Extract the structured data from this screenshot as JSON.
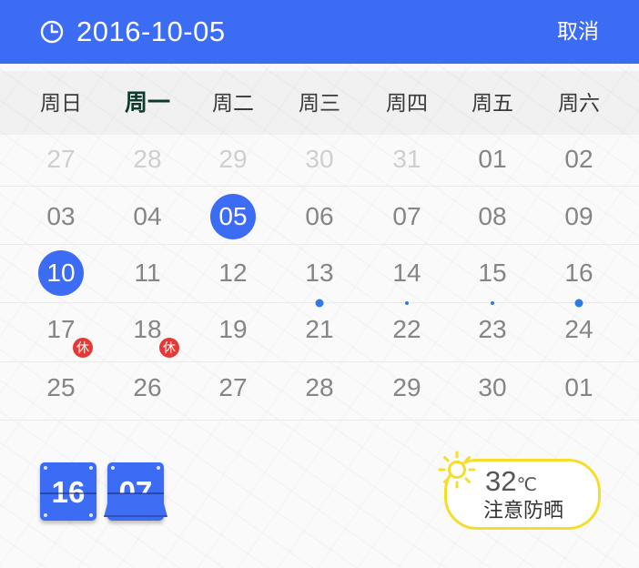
{
  "header": {
    "date": "2016-10-05",
    "cancel_label": "取消",
    "icon": "clock-icon"
  },
  "weekdays": [
    "周日",
    "周一",
    "周二",
    "周三",
    "周四",
    "周五",
    "周六"
  ],
  "active_weekday_index": 1,
  "calendar": {
    "rows": [
      [
        {
          "label": "27",
          "state": "faded"
        },
        {
          "label": "28",
          "state": "faded"
        },
        {
          "label": "29",
          "state": "faded"
        },
        {
          "label": "30",
          "state": "faded"
        },
        {
          "label": "31",
          "state": "faded"
        },
        {
          "label": "01",
          "state": "normal"
        },
        {
          "label": "02",
          "state": "normal"
        }
      ],
      [
        {
          "label": "03",
          "state": "normal"
        },
        {
          "label": "04",
          "state": "normal"
        },
        {
          "label": "05",
          "state": "selected"
        },
        {
          "label": "06",
          "state": "normal"
        },
        {
          "label": "07",
          "state": "normal"
        },
        {
          "label": "08",
          "state": "normal"
        },
        {
          "label": "09",
          "state": "normal"
        }
      ],
      [
        {
          "label": "10",
          "state": "today"
        },
        {
          "label": "11",
          "state": "normal"
        },
        {
          "label": "12",
          "state": "normal"
        },
        {
          "label": "13",
          "state": "normal",
          "dot": "big"
        },
        {
          "label": "14",
          "state": "normal",
          "dot": "small"
        },
        {
          "label": "15",
          "state": "normal",
          "dot": "small"
        },
        {
          "label": "16",
          "state": "normal",
          "dot": "big"
        }
      ],
      [
        {
          "label": "17",
          "state": "normal",
          "badge": "休"
        },
        {
          "label": "18",
          "state": "normal",
          "badge": "休"
        },
        {
          "label": "19",
          "state": "normal"
        },
        {
          "label": "21",
          "state": "normal"
        },
        {
          "label": "22",
          "state": "normal"
        },
        {
          "label": "23",
          "state": "normal"
        },
        {
          "label": "24",
          "state": "normal"
        }
      ],
      [
        {
          "label": "25",
          "state": "normal"
        },
        {
          "label": "26",
          "state": "normal"
        },
        {
          "label": "27",
          "state": "normal"
        },
        {
          "label": "28",
          "state": "normal"
        },
        {
          "label": "29",
          "state": "normal"
        },
        {
          "label": "30",
          "state": "normal"
        },
        {
          "label": "01",
          "state": "normal"
        }
      ]
    ]
  },
  "clock": {
    "hour": "16",
    "minute": "07"
  },
  "weather": {
    "temperature": "32",
    "unit": "℃",
    "advice": "注意防晒",
    "icon": "sun-icon"
  },
  "colors": {
    "accent": "#3d6cf4",
    "holiday": "#e53935",
    "event_dot": "#2f7ae6",
    "weather_border": "#f4de2a"
  }
}
